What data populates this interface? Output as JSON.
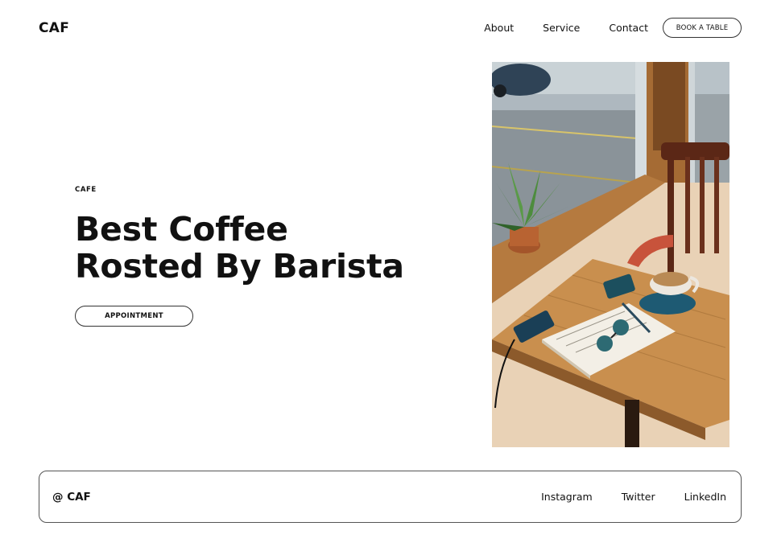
{
  "brand": {
    "logo": "CAF"
  },
  "nav": {
    "links": [
      "About",
      "Service",
      "Contact"
    ],
    "cta_label": "BOOK A TABLE"
  },
  "hero": {
    "eyebrow": "CAFE",
    "headline_line1": "Best Coffee",
    "headline_line2": "Rosted By Barista",
    "cta_label": "APPOINTMENT",
    "image_alt": "Cafe table with coffee cup, notebook and glasses by the window"
  },
  "footer": {
    "brand": "@ CAF",
    "social": [
      "Instagram",
      "Twitter",
      "LinkedIn"
    ]
  }
}
